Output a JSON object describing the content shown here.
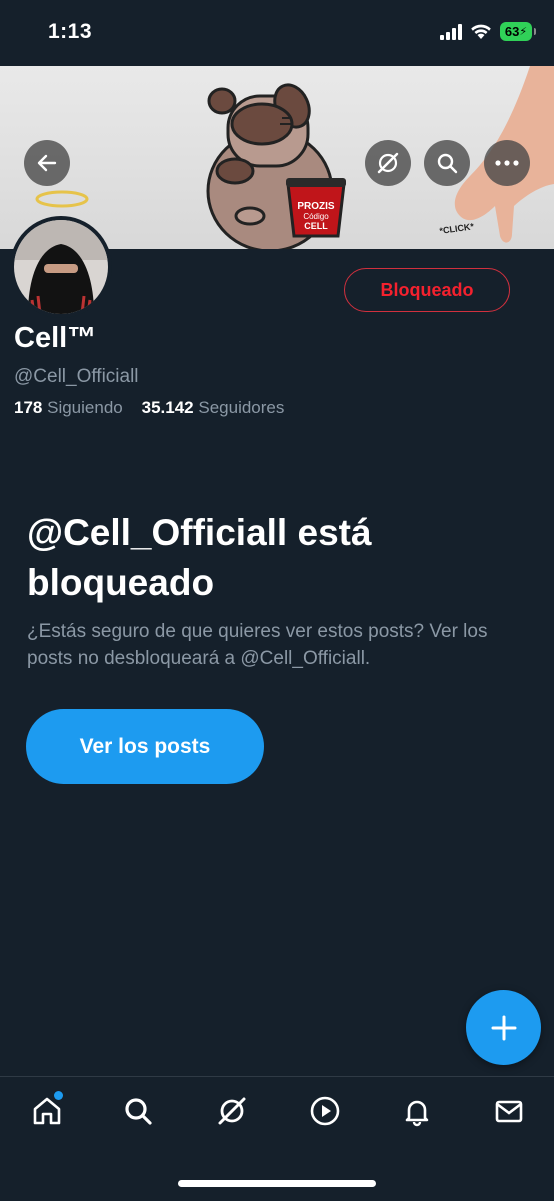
{
  "status_bar": {
    "time": "1:13",
    "battery": "63"
  },
  "banner": {
    "cup_text_1": "PROZIS",
    "cup_text_2": "Código",
    "cup_text_3": "CELL",
    "click_text": "*CLICK*"
  },
  "profile": {
    "name": "Cell™",
    "handle": "@Cell_Officiall",
    "following_count": "178",
    "following_label": "Siguiendo",
    "followers_count": "35.142",
    "followers_label": "Seguidores",
    "blocked_button": "Bloqueado"
  },
  "blocked_notice": {
    "title": "@Cell_Officiall está bloqueado",
    "description": "¿Estás seguro de que quieres ver estos posts? Ver los posts no desbloqueará a @Cell_Officiall.",
    "view_button": "Ver los posts"
  },
  "nav": {
    "icons": [
      "home-icon",
      "search-icon",
      "grok-icon",
      "video-icon",
      "notifications-icon",
      "messages-icon"
    ]
  },
  "colors": {
    "background": "#15202b",
    "accent": "#1d9bf0",
    "blocked": "#f4212e",
    "muted": "#8b98a5"
  }
}
